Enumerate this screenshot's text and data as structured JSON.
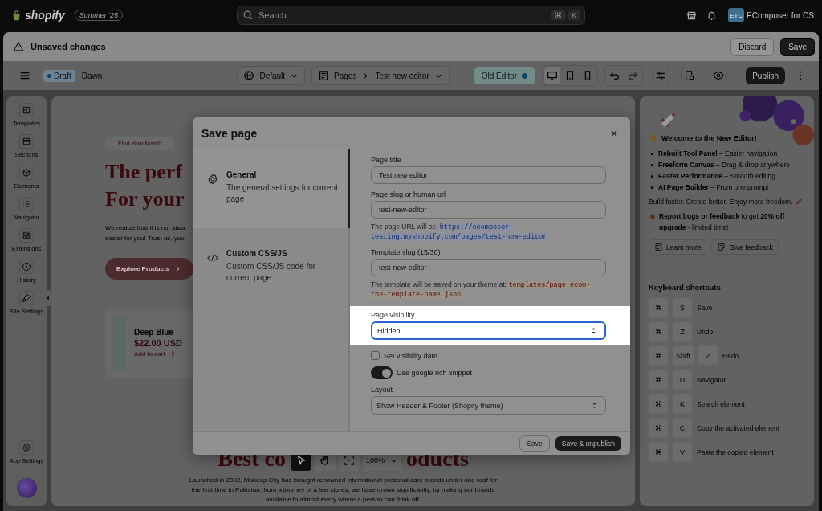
{
  "topbar": {
    "logo": "shopify",
    "edition": "Summer '25",
    "search": {
      "placeholder": "Search",
      "keys": [
        "⌘",
        "K"
      ]
    },
    "store": {
      "initials": "ETC",
      "name": "EComposer for CS"
    }
  },
  "unsaved_bar": {
    "message": "Unsaved changes",
    "buttons": [
      {
        "label": "Discard",
        "kind": "secondary"
      },
      {
        "label": "Save",
        "kind": "primary"
      }
    ]
  },
  "toolbar": {
    "status": "Draft",
    "theme": "Dawn",
    "template": "Default",
    "breadcrumb": [
      "Pages",
      "Test new editor"
    ],
    "old_editor": {
      "label": "Old Editor",
      "on": true
    },
    "devices": [
      {
        "kind": "desktop",
        "selected": true
      },
      {
        "kind": "tablet",
        "selected": false
      },
      {
        "kind": "mobile",
        "selected": false
      }
    ],
    "publish": "Publish"
  },
  "sidebar": {
    "items": [
      {
        "label": "Templates"
      },
      {
        "label": "Sections"
      },
      {
        "label": "Elements"
      },
      {
        "label": "Navigator"
      },
      {
        "label": "Extensions"
      },
      {
        "label": "History"
      },
      {
        "label": "Site Settings"
      }
    ],
    "footer": "App Settings"
  },
  "canvas": {
    "eyebrow": "Find Your Match",
    "heading": [
      "The perf",
      "For your"
    ],
    "intro": [
      "We realize that it is not alwa",
      "easier for you! Trust us, you"
    ],
    "cta": "Explore Products",
    "product": {
      "name": "Deep Blue",
      "price": "$22.00 USD",
      "action": "Add to cart"
    },
    "section_heading": [
      "Best co",
      "oducts"
    ],
    "section_text": "Launched in 2002, Makeup City has brought renowned international personal care brands under one roof for the first time in Pakistan. from a journey of a few stores, we have grown significantly, by making our brands available to almost every where a person can think off."
  },
  "float_toolbar": {
    "tools": [
      {
        "kind": "pointer",
        "selected": true
      },
      {
        "kind": "hand",
        "selected": false
      },
      {
        "kind": "focus",
        "selected": false
      }
    ],
    "zoom": "100%"
  },
  "modal": {
    "title": "Save page",
    "nav": [
      {
        "kind": "general",
        "title": "General",
        "description": "The general settings for current page",
        "selected": true
      },
      {
        "kind": "code",
        "title": "Custom CSS/JS",
        "description": "Custom CSS/JS code for current page",
        "selected": false
      }
    ],
    "fields": [
      {
        "kind": "text",
        "label": "Page title",
        "value": "Test new editor"
      },
      {
        "kind": "text",
        "label": "Page slug or human url",
        "value": "test-new-editor",
        "note": "The page URL will be:",
        "code": "https://ecomposer-testing.myshopify.com/pages/test-new-editor"
      },
      {
        "kind": "text",
        "label": "Template slug (15/30)",
        "value": "test-new-editor",
        "note": "The template will be saved on your theme at:",
        "code": "templates/page.ecom-the-template-name.json"
      },
      {
        "kind": "select",
        "label": "Page visibility",
        "value": "Hidden",
        "highlighted": true
      },
      {
        "kind": "checkbox",
        "label": "Set visibility date",
        "checked": false
      },
      {
        "kind": "toggle",
        "label": "Use google rich snippet",
        "on": true
      },
      {
        "kind": "select",
        "label": "Layout",
        "value": "Show Header & Footer (Shopify theme)",
        "highlighted": false
      }
    ],
    "buttons": [
      {
        "label": "Save",
        "kind": "secondary"
      },
      {
        "label": "Save & unpublish",
        "kind": "primary"
      }
    ]
  },
  "right_panel": {
    "welcome": "Welcome to the New Editor!",
    "features": [
      "**Rebuilt Tool Panel** – Easier navigation",
      "**Freeform Canvas** – Drag & drop anywhere",
      "**Faster Performance** – Smooth editing",
      "**AI Page Builder** – From one prompt"
    ],
    "tagline": "Build faster. Create better. Enjoy more freedom.",
    "promo": "**Report bugs or feedback** to get **20% off upgrade** - limited time!",
    "buttons": [
      "Learn more",
      "Give feedback"
    ],
    "shortcuts_title": "Keyboard shortcuts",
    "shortcuts": [
      {
        "keys": [
          "⌘",
          "S"
        ],
        "action": "Save"
      },
      {
        "keys": [
          "⌘",
          "Z"
        ],
        "action": "Undo"
      },
      {
        "keys": [
          "⌘",
          "Shift",
          "Z"
        ],
        "action": "Redo"
      },
      {
        "keys": [
          "⌘",
          "U"
        ],
        "action": "Navigator"
      },
      {
        "keys": [
          "⌘",
          "K"
        ],
        "action": "Search element"
      },
      {
        "keys": [
          "⌘",
          "C"
        ],
        "action": "Copy the activated element"
      },
      {
        "keys": [
          "⌘",
          "V"
        ],
        "action": "Paste the copied element"
      }
    ]
  }
}
